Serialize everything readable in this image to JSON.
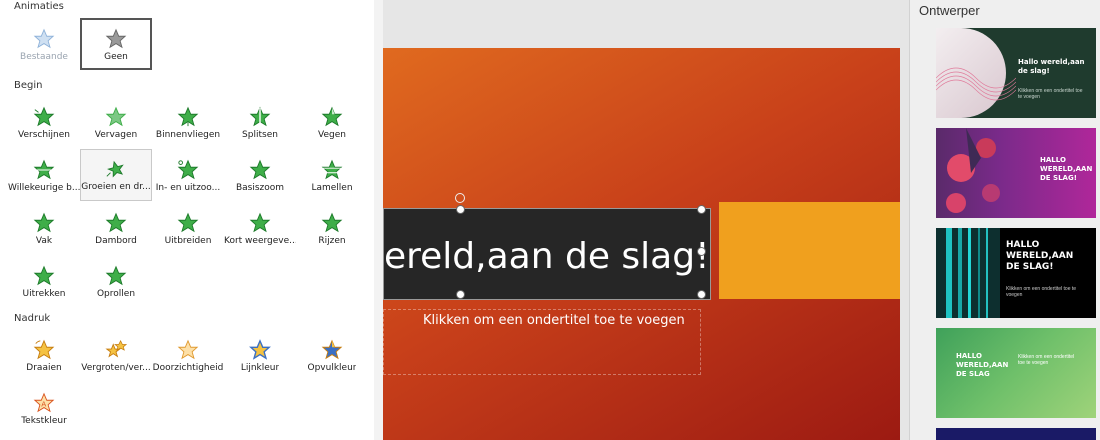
{
  "colors": {
    "star_green": "#3fae49",
    "star_gold": "#f0a030",
    "slide_orange": "#e06a1f",
    "slide_red": "#9c1a12",
    "accent_bar": "#f0a01e"
  },
  "animations_pane": {
    "sections": {
      "animations": "Animaties",
      "begin": "Begin",
      "emphasis": "Nadruk"
    },
    "top_effects": [
      {
        "label": "Bestaande",
        "icon": "star-outline-icon"
      },
      {
        "label": "Geen",
        "icon": "star-gray-icon"
      }
    ],
    "begin_effects": [
      {
        "label": "Verschijnen",
        "icon": "star-appear-icon"
      },
      {
        "label": "Vervagen",
        "icon": "star-fade-icon"
      },
      {
        "label": "Binnenvliegen",
        "icon": "star-fly-in-icon"
      },
      {
        "label": "Splitsen",
        "icon": "star-split-icon"
      },
      {
        "label": "Vegen",
        "icon": "star-wipe-icon"
      },
      {
        "label": "Willekeurige b...",
        "icon": "star-random-bars-icon"
      },
      {
        "label": "Groeien en dr...",
        "icon": "star-grow-turn-icon"
      },
      {
        "label": "In- en uitzoo...",
        "icon": "star-zoom-icon"
      },
      {
        "label": "Basiszoom",
        "icon": "star-basic-zoom-icon"
      },
      {
        "label": "Lamellen",
        "icon": "star-blinds-icon"
      },
      {
        "label": "Vak",
        "icon": "star-box-icon"
      },
      {
        "label": "Dambord",
        "icon": "star-checkerboard-icon"
      },
      {
        "label": "Uitbreiden",
        "icon": "star-expand-icon"
      },
      {
        "label": "Kort weergeve...",
        "icon": "star-flash-icon"
      },
      {
        "label": "Rijzen",
        "icon": "star-rise-icon"
      },
      {
        "label": "Uitrekken",
        "icon": "star-stretch-icon"
      },
      {
        "label": "Oprollen",
        "icon": "star-unfold-icon"
      }
    ],
    "emphasis_effects": [
      {
        "label": "Draaien",
        "icon": "star-spin-icon"
      },
      {
        "label": "Vergroten/ver...",
        "icon": "star-grow-shrink-icon"
      },
      {
        "label": "Doorzichtigheid",
        "icon": "star-transparency-icon"
      },
      {
        "label": "Lijnkleur",
        "icon": "star-line-color-icon"
      },
      {
        "label": "Opvulkleur",
        "icon": "star-fill-color-icon"
      },
      {
        "label": "Tekstkleur",
        "icon": "star-font-color-icon"
      }
    ]
  },
  "slide": {
    "title": "ereld,aan de slag!",
    "subtitle_placeholder": "Klikken om een ondertitel toe te voegen"
  },
  "designer": {
    "title": "Ontwerper",
    "thumbnails": [
      {
        "title": "Hallo wereld,aan de slag!",
        "subtitle": "Klikken om een ondertitel toe te voegen"
      },
      {
        "title": "HALLO WERELD,AAN DE SLAG!",
        "subtitle": ""
      },
      {
        "title": "HALLO WERELD,AAN DE SLAG!",
        "subtitle": "Klikken om een ondertitel toe te voegen"
      },
      {
        "title": "HALLO WERELD,AAN DE SLAG",
        "subtitle": "Klikken om een ondertitel toe te voegen"
      }
    ]
  }
}
